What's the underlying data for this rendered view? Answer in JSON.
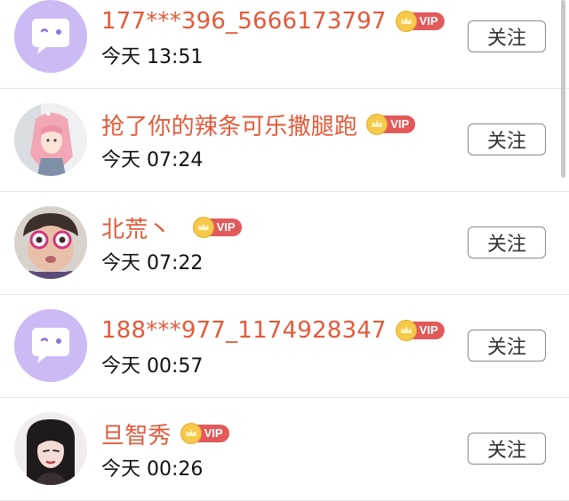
{
  "follow_list": [
    {
      "name": "177***396_5666173797",
      "time": "今天 13:51",
      "vip_label": "VIP",
      "button": "关注",
      "avatar": "default-chat-bubble-avatar"
    },
    {
      "name": "抢了你的辣条可乐撒腿跑",
      "time": "今天 07:24",
      "vip_label": "VIP",
      "button": "关注",
      "avatar": "anime-girl-avatar"
    },
    {
      "name": "北荒丶",
      "time": "今天 07:22",
      "vip_label": "VIP",
      "button": "关注",
      "avatar": "child-photo-avatar"
    },
    {
      "name": "188***977_1174928347",
      "time": "今天 00:57",
      "vip_label": "VIP",
      "button": "关注",
      "avatar": "default-chat-bubble-avatar"
    },
    {
      "name": "旦智秀",
      "time": "今天 00:26",
      "vip_label": "VIP",
      "button": "关注",
      "avatar": "portrait-photo-avatar"
    }
  ],
  "colors": {
    "name": "#e35a3a",
    "vip_badge": "#e3595a",
    "crown": "#f6c94a",
    "default_avatar": "#c9b8f3"
  }
}
